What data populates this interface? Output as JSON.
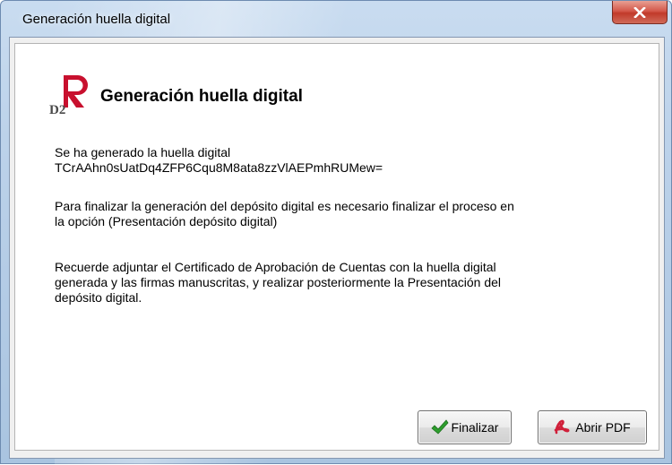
{
  "window": {
    "title": "Generación huella digital"
  },
  "dialog": {
    "heading": "Generación huella digital",
    "logo": {
      "icon": "d2-r-logo-icon",
      "letter": "R",
      "subtext": "D2",
      "brand_color": "#c8102e"
    },
    "message_lines": [
      "Se ha generado la huella digital",
      "TCrAAhn0sUatDq4ZFP6Cqu8M8ata8zzVlAEPmhRUMew="
    ],
    "instruction_lines": [
      "Para finalizar la generación del depósito digital es necesario finalizar el proceso en",
      "la opción (Presentación depósito digital)"
    ],
    "reminder_lines": [
      "Recuerde adjuntar el Certificado de Aprobación de Cuentas con la huella digital",
      "generada y las firmas manuscritas, y realizar posteriormente la Presentación del",
      "depósito digital."
    ]
  },
  "buttons": {
    "finalizar": {
      "label": "Finalizar",
      "icon": "checkmark-icon",
      "icon_color": "#2e9e2e"
    },
    "abrir_pdf": {
      "label": "Abrir PDF",
      "icon": "pdf-icon",
      "icon_color": "#d0203a"
    }
  }
}
